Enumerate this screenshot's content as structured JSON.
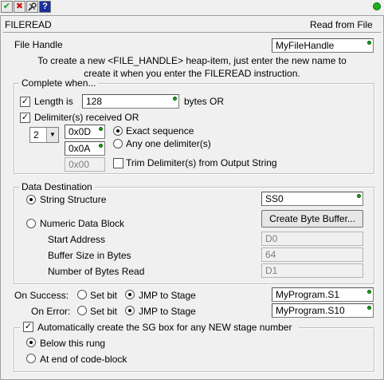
{
  "toolbar": {
    "ok_icon": "checkmark-icon",
    "cancel_icon": "x-icon",
    "tool_icon": "wrench-icon",
    "help_label": "?"
  },
  "header": {
    "left_title": "FILEREAD",
    "right_title": "Read from File"
  },
  "file_handle": {
    "label": "File Handle",
    "value": "MyFileHandle",
    "help_line1": "To create a new <FILE_HANDLE> heap-item, just enter the new name to",
    "help_line2": "create it when you enter the FILEREAD instruction."
  },
  "complete_when": {
    "title": "Complete when...",
    "length_label": "Length is",
    "length_checked": true,
    "length_value": "128",
    "length_unit": "bytes OR",
    "delimiter_label": "Delimiter(s) received OR",
    "delimiter_checked": true,
    "delimiter_count": "2",
    "delimiters": [
      "0x0D",
      "0x0A",
      "0x00"
    ],
    "exact_label": "Exact sequence",
    "any_label": "Any one delimiter(s)",
    "trim_label": "Trim Delimiter(s) from Output String",
    "trim_checked": false
  },
  "data_destination": {
    "title": "Data Destination",
    "string_label": "String Structure",
    "string_value": "SS0",
    "numeric_label": "Numeric Data Block",
    "create_button": "Create Byte Buffer...",
    "start_label": "Start Address",
    "start_value": "D0",
    "size_label": "Buffer Size in Bytes",
    "size_value": "64",
    "bytes_read_label": "Number of Bytes Read",
    "bytes_read_value": "D1"
  },
  "on_success": {
    "label": "On Success:",
    "set_bit_label": "Set bit",
    "jmp_label": "JMP to Stage",
    "value": "MyProgram.S1"
  },
  "on_error": {
    "label": "On Error:",
    "set_bit_label": "Set bit",
    "jmp_label": "JMP to Stage",
    "value": "MyProgram.S10"
  },
  "sg_box": {
    "title": "Automatically create the SG box for any NEW stage number",
    "checked": true,
    "below_label": "Below this rung",
    "end_label": "At end of code-block"
  },
  "colors": {
    "ok_green": "#1e9b1e",
    "cancel_red": "#d01010",
    "help_blue": "#1a2f9e",
    "status_green": "#1fae1f"
  }
}
